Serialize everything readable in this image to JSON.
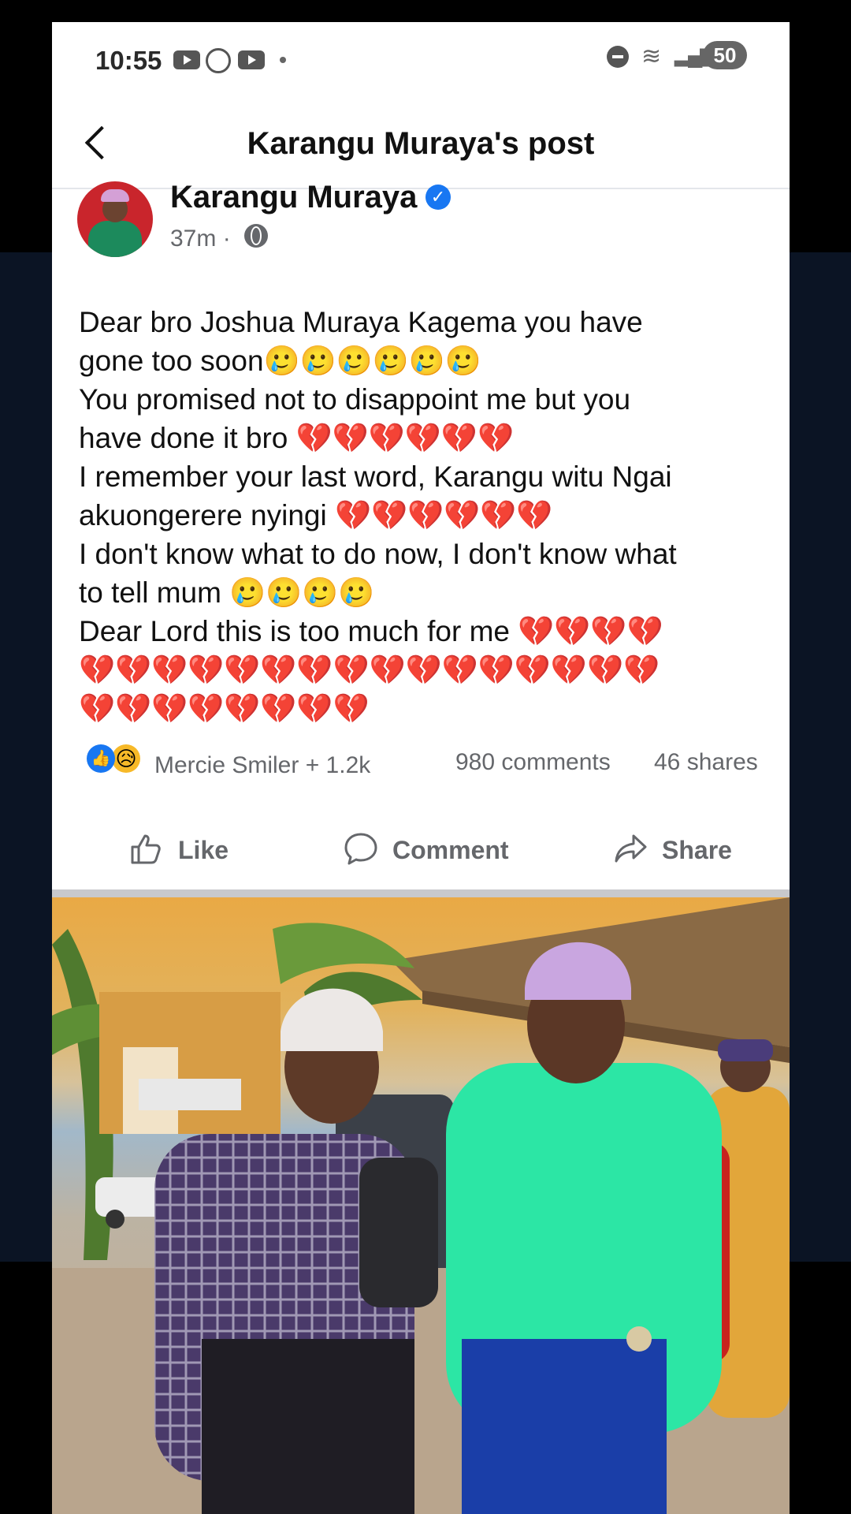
{
  "status_bar": {
    "time": "10:55",
    "battery": "50"
  },
  "header": {
    "title": "Karangu Muraya's post"
  },
  "post": {
    "author": "Karangu Muraya",
    "time": "37m ·",
    "lines": [
      "Dear bro Joshua Muraya Kagema you have",
      "gone too soon🥲🥲🥲🥲🥲🥲",
      "You promised not to disappoint me but you",
      "have done it bro 💔💔💔💔💔💔",
      "I remember your last word, Karangu witu Ngai",
      "akuongerere nyingi 💔💔💔💔💔💔",
      "I don't know what to do now, I don't know what",
      "to tell mum 🥲🥲🥲🥲",
      "Dear Lord this is too much for me 💔💔💔💔",
      "💔💔💔💔💔💔💔💔💔💔💔💔💔💔💔💔",
      "💔💔💔💔💔💔💔💔"
    ]
  },
  "stats": {
    "reactors": "Mercie Smiler + 1.2k",
    "comments": "980 comments",
    "shares": "46 shares"
  },
  "actions": {
    "like": "Like",
    "comment": "Comment",
    "share": "Share"
  },
  "colors": {
    "brand_blue": "#1877f2",
    "meta_gray": "#65676b"
  }
}
